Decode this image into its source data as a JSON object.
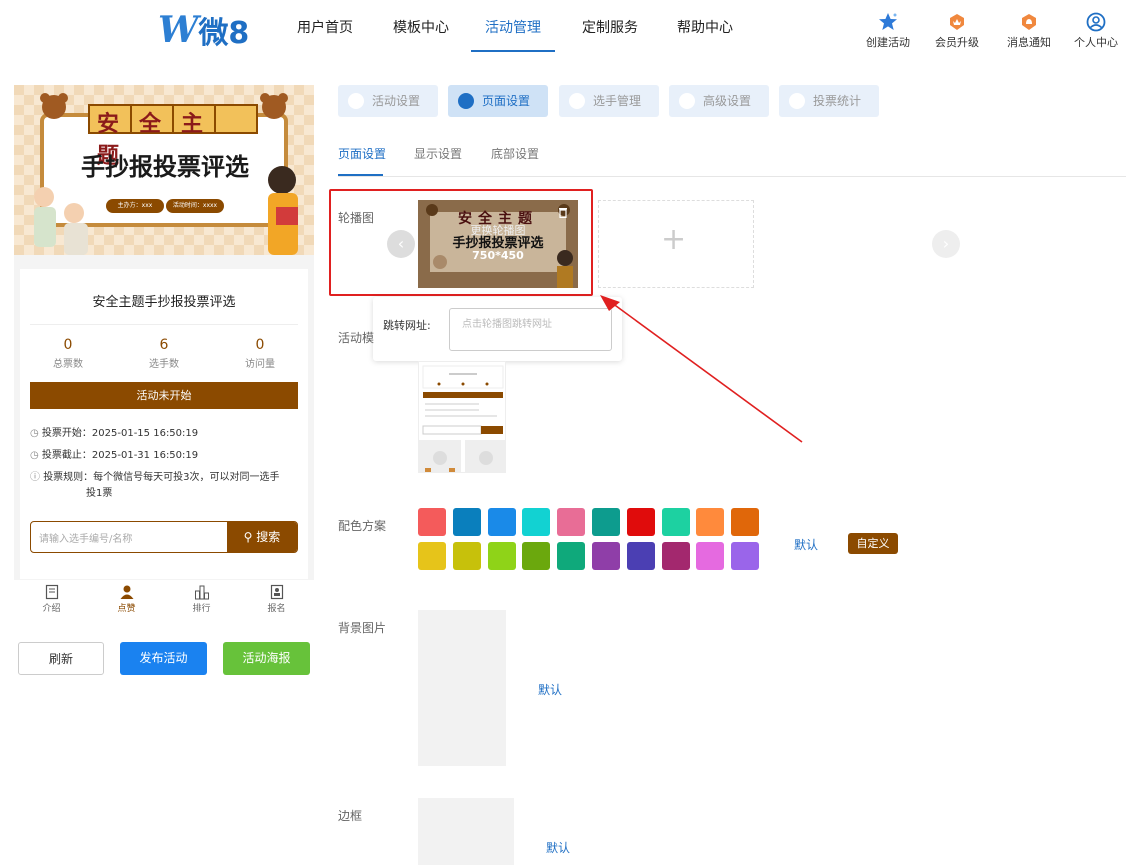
{
  "header": {
    "logo_letter": "W",
    "logo_text": "微8",
    "nav": [
      "用户首页",
      "模板中心",
      "活动管理",
      "定制服务",
      "帮助中心"
    ],
    "active_nav": 2,
    "right": [
      "创建活动",
      "会员升级",
      "消息通知",
      "个人中心"
    ]
  },
  "preview": {
    "banner_title": "安全主题",
    "banner_subtitle": "手抄报投票评选",
    "banner_host": "主办方：xxx",
    "banner_time": "活动时间：xxxx",
    "title": "安全主题手抄报投票评选",
    "stats": [
      {
        "value": "0",
        "label": "总票数"
      },
      {
        "value": "6",
        "label": "选手数"
      },
      {
        "value": "0",
        "label": "访问量"
      }
    ],
    "status_button": "活动未开始",
    "vote_start": "投票开始：2025-01-15 16:50:19",
    "vote_end": "投票截止：2025-01-31 16:50:19",
    "rule_1": "投票规则：每个微信号每天可投3次，可以对同一选手",
    "rule_2": "投1票",
    "search_placeholder": "请输入选手编号/名称",
    "search_button": "搜索",
    "bottom_nav": [
      "介绍",
      "点赞",
      "排行",
      "报名"
    ]
  },
  "actions": {
    "refresh": "刷新",
    "publish": "发布活动",
    "poster": "活动海报"
  },
  "tabs": [
    "活动设置",
    "页面设置",
    "选手管理",
    "高级设置",
    "投票统计"
  ],
  "active_tab": 1,
  "subtabs": [
    "页面设置",
    "显示设置",
    "底部设置"
  ],
  "carousel": {
    "label": "轮播图",
    "replace_text": "更换轮播图",
    "thumb_title": "安全主题",
    "thumb_subtitle": "手抄报投票评选",
    "thumb_size": "750*450",
    "jump_label": "跳转网址:",
    "jump_placeholder": "点击轮播图跳转网址"
  },
  "activity_template_label": "活动模",
  "color_scheme": {
    "label": "配色方案",
    "colors": [
      "#f45b5b",
      "#0a7fbd",
      "#1a8ae8",
      "#12d2d2",
      "#e86d96",
      "#0d9c8e",
      "#e00c0c",
      "#1dd1a1",
      "#ff8a3c",
      "#e0670a",
      "#e6c41a",
      "#c7c10b",
      "#8fd318",
      "#6ba80d",
      "#0fa97b",
      "#8f3ea8",
      "#4b3fb3",
      "#a3286e",
      "#e56ae0",
      "#9a65ea"
    ],
    "default_link": "默认",
    "custom_button": "自定义"
  },
  "background": {
    "label": "背景图片",
    "default_link": "默认"
  },
  "border": {
    "label": "边框",
    "default_link": "默认"
  }
}
